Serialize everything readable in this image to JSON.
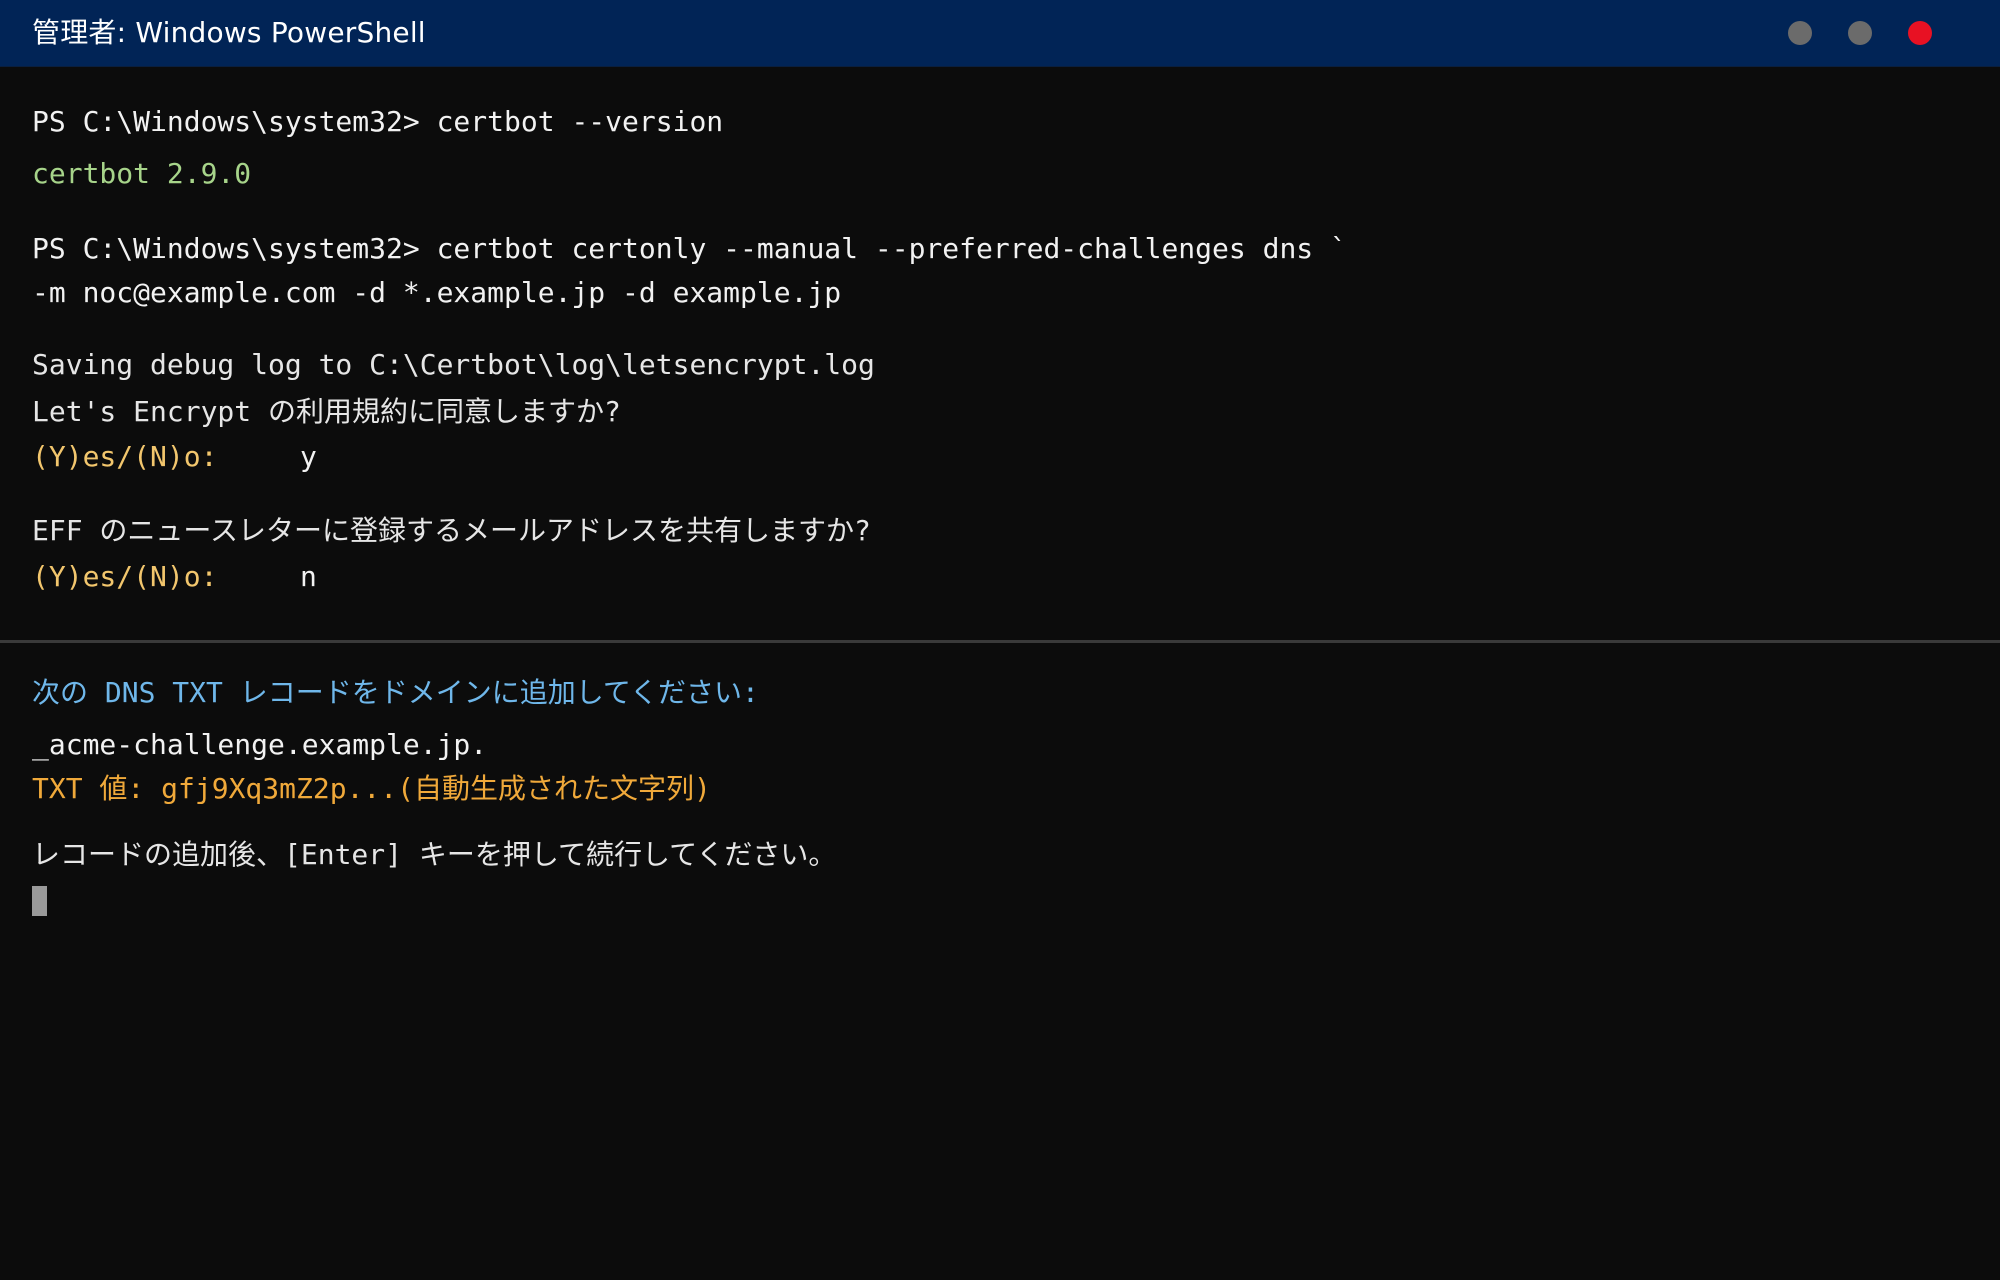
{
  "window": {
    "title": "管理者: Windows PowerShell",
    "controls": [
      "minimize",
      "maximize",
      "close"
    ]
  },
  "terminal": {
    "prompt_1": "PS C:\\Windows\\system32> certbot --version",
    "version_output": "certbot 2.9.0",
    "prompt_2": "PS C:\\Windows\\system32> certbot certonly --manual --preferred-challenges dns `",
    "prompt_2_cont": "-m noc@example.com -d *.example.jp -d example.jp",
    "debug_log": "Saving debug log to C:\\Certbot\\log\\letsencrypt.log",
    "tos_question": "Let's Encrypt の利用規約に同意しますか?",
    "tos_choice": "(Y)es/(N)o:",
    "tos_answer": "y",
    "eff_question": "EFF のニュースレターに登録するメールアドレスを共有しますか?",
    "eff_choice": "(Y)es/(N)o:",
    "eff_answer": "n"
  },
  "dns_pane": {
    "instruction": "次の DNS TXT レコードをドメインに追加してください:",
    "record_name": "_acme-challenge.example.jp.",
    "txt_value": "TXT 値: gfj9Xq3mZ2p...(自動生成された文字列)",
    "continue_prompt": "レコードの追加後、[Enter] キーを押して続行してください。"
  },
  "colors": {
    "titlebar": "#012456",
    "background": "#0c0c0c",
    "output_green": "#a7d48a",
    "prompt_yellow": "#f2c66d",
    "info_cyan": "#6fb7ea",
    "value_orange": "#f0a93a",
    "close_red": "#e81123"
  }
}
